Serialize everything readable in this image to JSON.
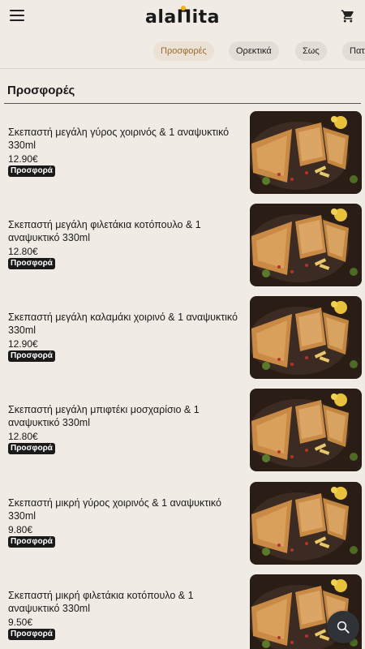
{
  "header": {
    "logo_text": "alaΠita"
  },
  "tabs": [
    {
      "label": "Προσφορές",
      "active": true
    },
    {
      "label": "Ορεκτικά",
      "active": false
    },
    {
      "label": "Σως",
      "active": false
    },
    {
      "label": "Πατ",
      "active": false
    }
  ],
  "section": {
    "title": "Προσφορές"
  },
  "items": [
    {
      "name": "Σκεπαστή μεγάλη γύρος χοιρινός & 1 αναψυκτικό 330ml",
      "price": "12.90€",
      "badge": "Προσφορά"
    },
    {
      "name": "Σκεπαστή μεγάλη φιλετάκια κοτόπουλο & 1 αναψυκτικό 330ml",
      "price": "12.80€",
      "badge": "Προσφορά"
    },
    {
      "name": "Σκεπαστή μεγάλη καλαμάκι χοιρινό & 1 αναψυκτικό 330ml",
      "price": "12.90€",
      "badge": "Προσφορά"
    },
    {
      "name": "Σκεπαστή μεγάλη μπιφτέκι μοσχαρίσιο & 1 αναψυκτικό 330ml",
      "price": "12.80€",
      "badge": "Προσφορά"
    },
    {
      "name": "Σκεπαστή μικρή γύρος χοιρινός & 1 αναψυκτικό 330ml",
      "price": "9.80€",
      "badge": "Προσφορά"
    },
    {
      "name": "Σκεπαστή μικρή φιλετάκια κοτόπουλο & 1 αναψυκτικό 330ml",
      "price": "9.50€",
      "badge": "Προσφορά"
    }
  ],
  "icons": {
    "menu": "menu-icon",
    "cart": "cart-icon",
    "search": "search-icon"
  },
  "colors": {
    "background": "#f0ebe4",
    "active_tab_text": "#9a6b2f",
    "badge_bg": "#1a1a1a",
    "fab_bg": "#2f3236",
    "logo_dot": "#f4b400"
  }
}
